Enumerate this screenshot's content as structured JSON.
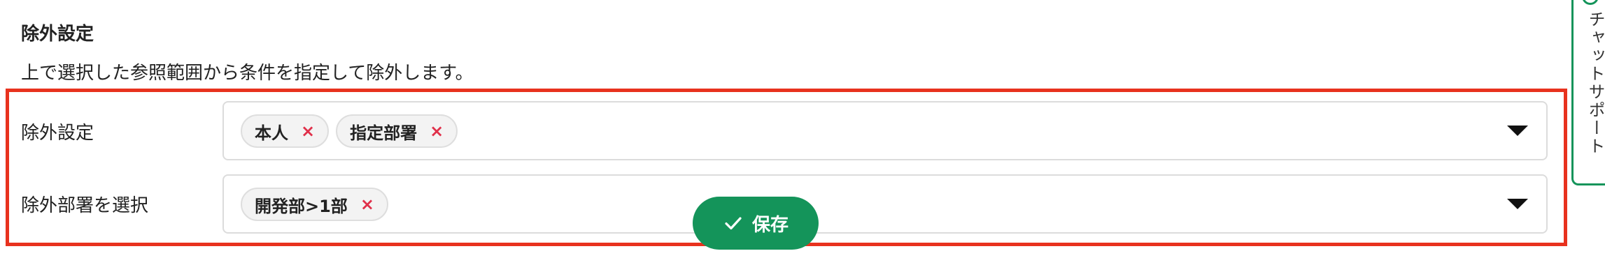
{
  "section": {
    "title": "除外設定",
    "description": "上で選択した参照範囲から条件を指定して除外します。"
  },
  "rows": [
    {
      "label": "除外設定",
      "chips": [
        {
          "label": "本人",
          "remove": "×"
        },
        {
          "label": "指定部署",
          "remove": "×"
        }
      ]
    },
    {
      "label": "除外部署を選択",
      "chips": [
        {
          "label": "開発部>1部",
          "remove": "×"
        }
      ]
    }
  ],
  "save_button": {
    "label": "保存",
    "icon": "check-icon"
  },
  "chat_support": {
    "label": "チャットサポート",
    "icon": "chat-icon"
  },
  "colors": {
    "accent": "#14945a",
    "highlight": "#e8321e",
    "remove": "#e0304a"
  }
}
